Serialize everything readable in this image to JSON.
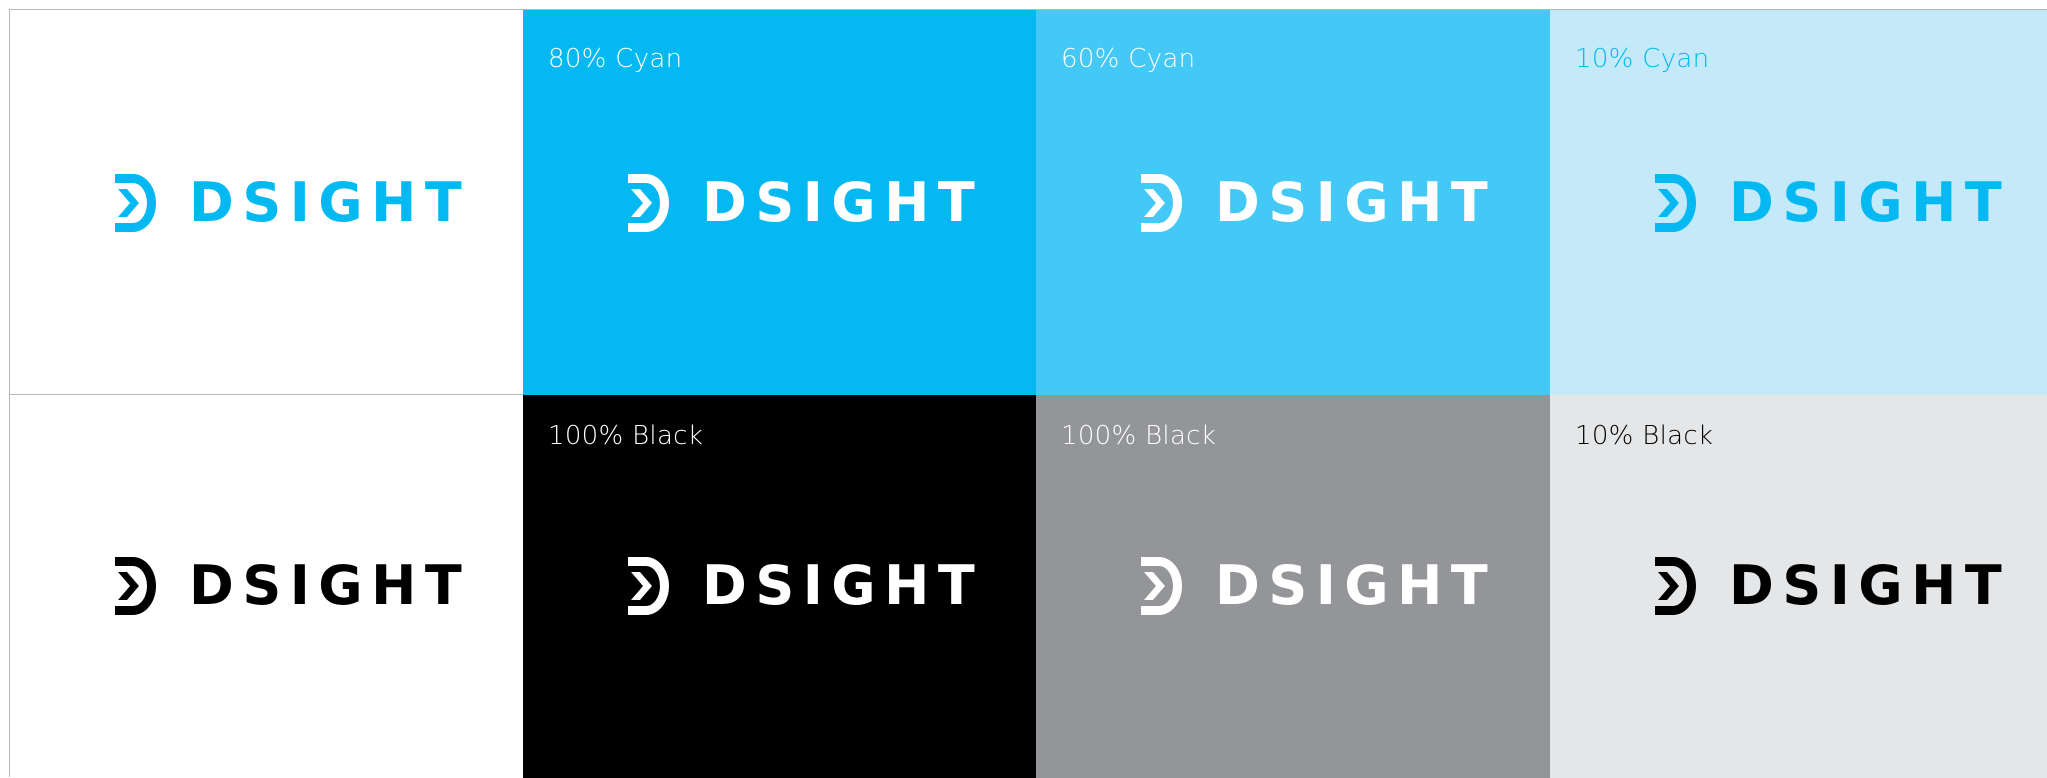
{
  "brand": {
    "name": "DSIGHT",
    "logo_icon": "d-chevron-logo-icon"
  },
  "colors": {
    "cyan": "#04b9f1",
    "cyan_80": "#04b9f1",
    "cyan_60": "#44c8f5",
    "cyan_10": "#c4e9f9",
    "black": "#000000",
    "gray": "#939598",
    "light_gray": "#e5e6e7",
    "white": "#ffffff"
  },
  "rows": [
    {
      "tiles": [
        {
          "label": "",
          "bg": "#ffffff",
          "logo_color": "#04b9f1",
          "label_color": ""
        },
        {
          "label": "80% Cyan",
          "bg": "#04b9f1",
          "logo_color": "#ffffff",
          "label_color": "#ffffff"
        },
        {
          "label": "60% Cyan",
          "bg": "#44c8f5",
          "logo_color": "#ffffff",
          "label_color": "#ffffff"
        },
        {
          "label": "10% Cyan",
          "bg": "#c4e9f9",
          "logo_color": "#04b9f1",
          "label_color": "#04b9f1"
        }
      ]
    },
    {
      "tiles": [
        {
          "label": "",
          "bg": "#ffffff",
          "logo_color": "#000000",
          "label_color": ""
        },
        {
          "label": "100% Black",
          "bg": "#000000",
          "logo_color": "#ffffff",
          "label_color": "#ffffff"
        },
        {
          "label": "100% Black",
          "bg": "#939598",
          "logo_color": "#ffffff",
          "label_color": "#ffffff"
        },
        {
          "label": "10% Black",
          "bg": "#e5e6e7",
          "logo_color": "#000000",
          "label_color": "#000000"
        }
      ]
    }
  ]
}
